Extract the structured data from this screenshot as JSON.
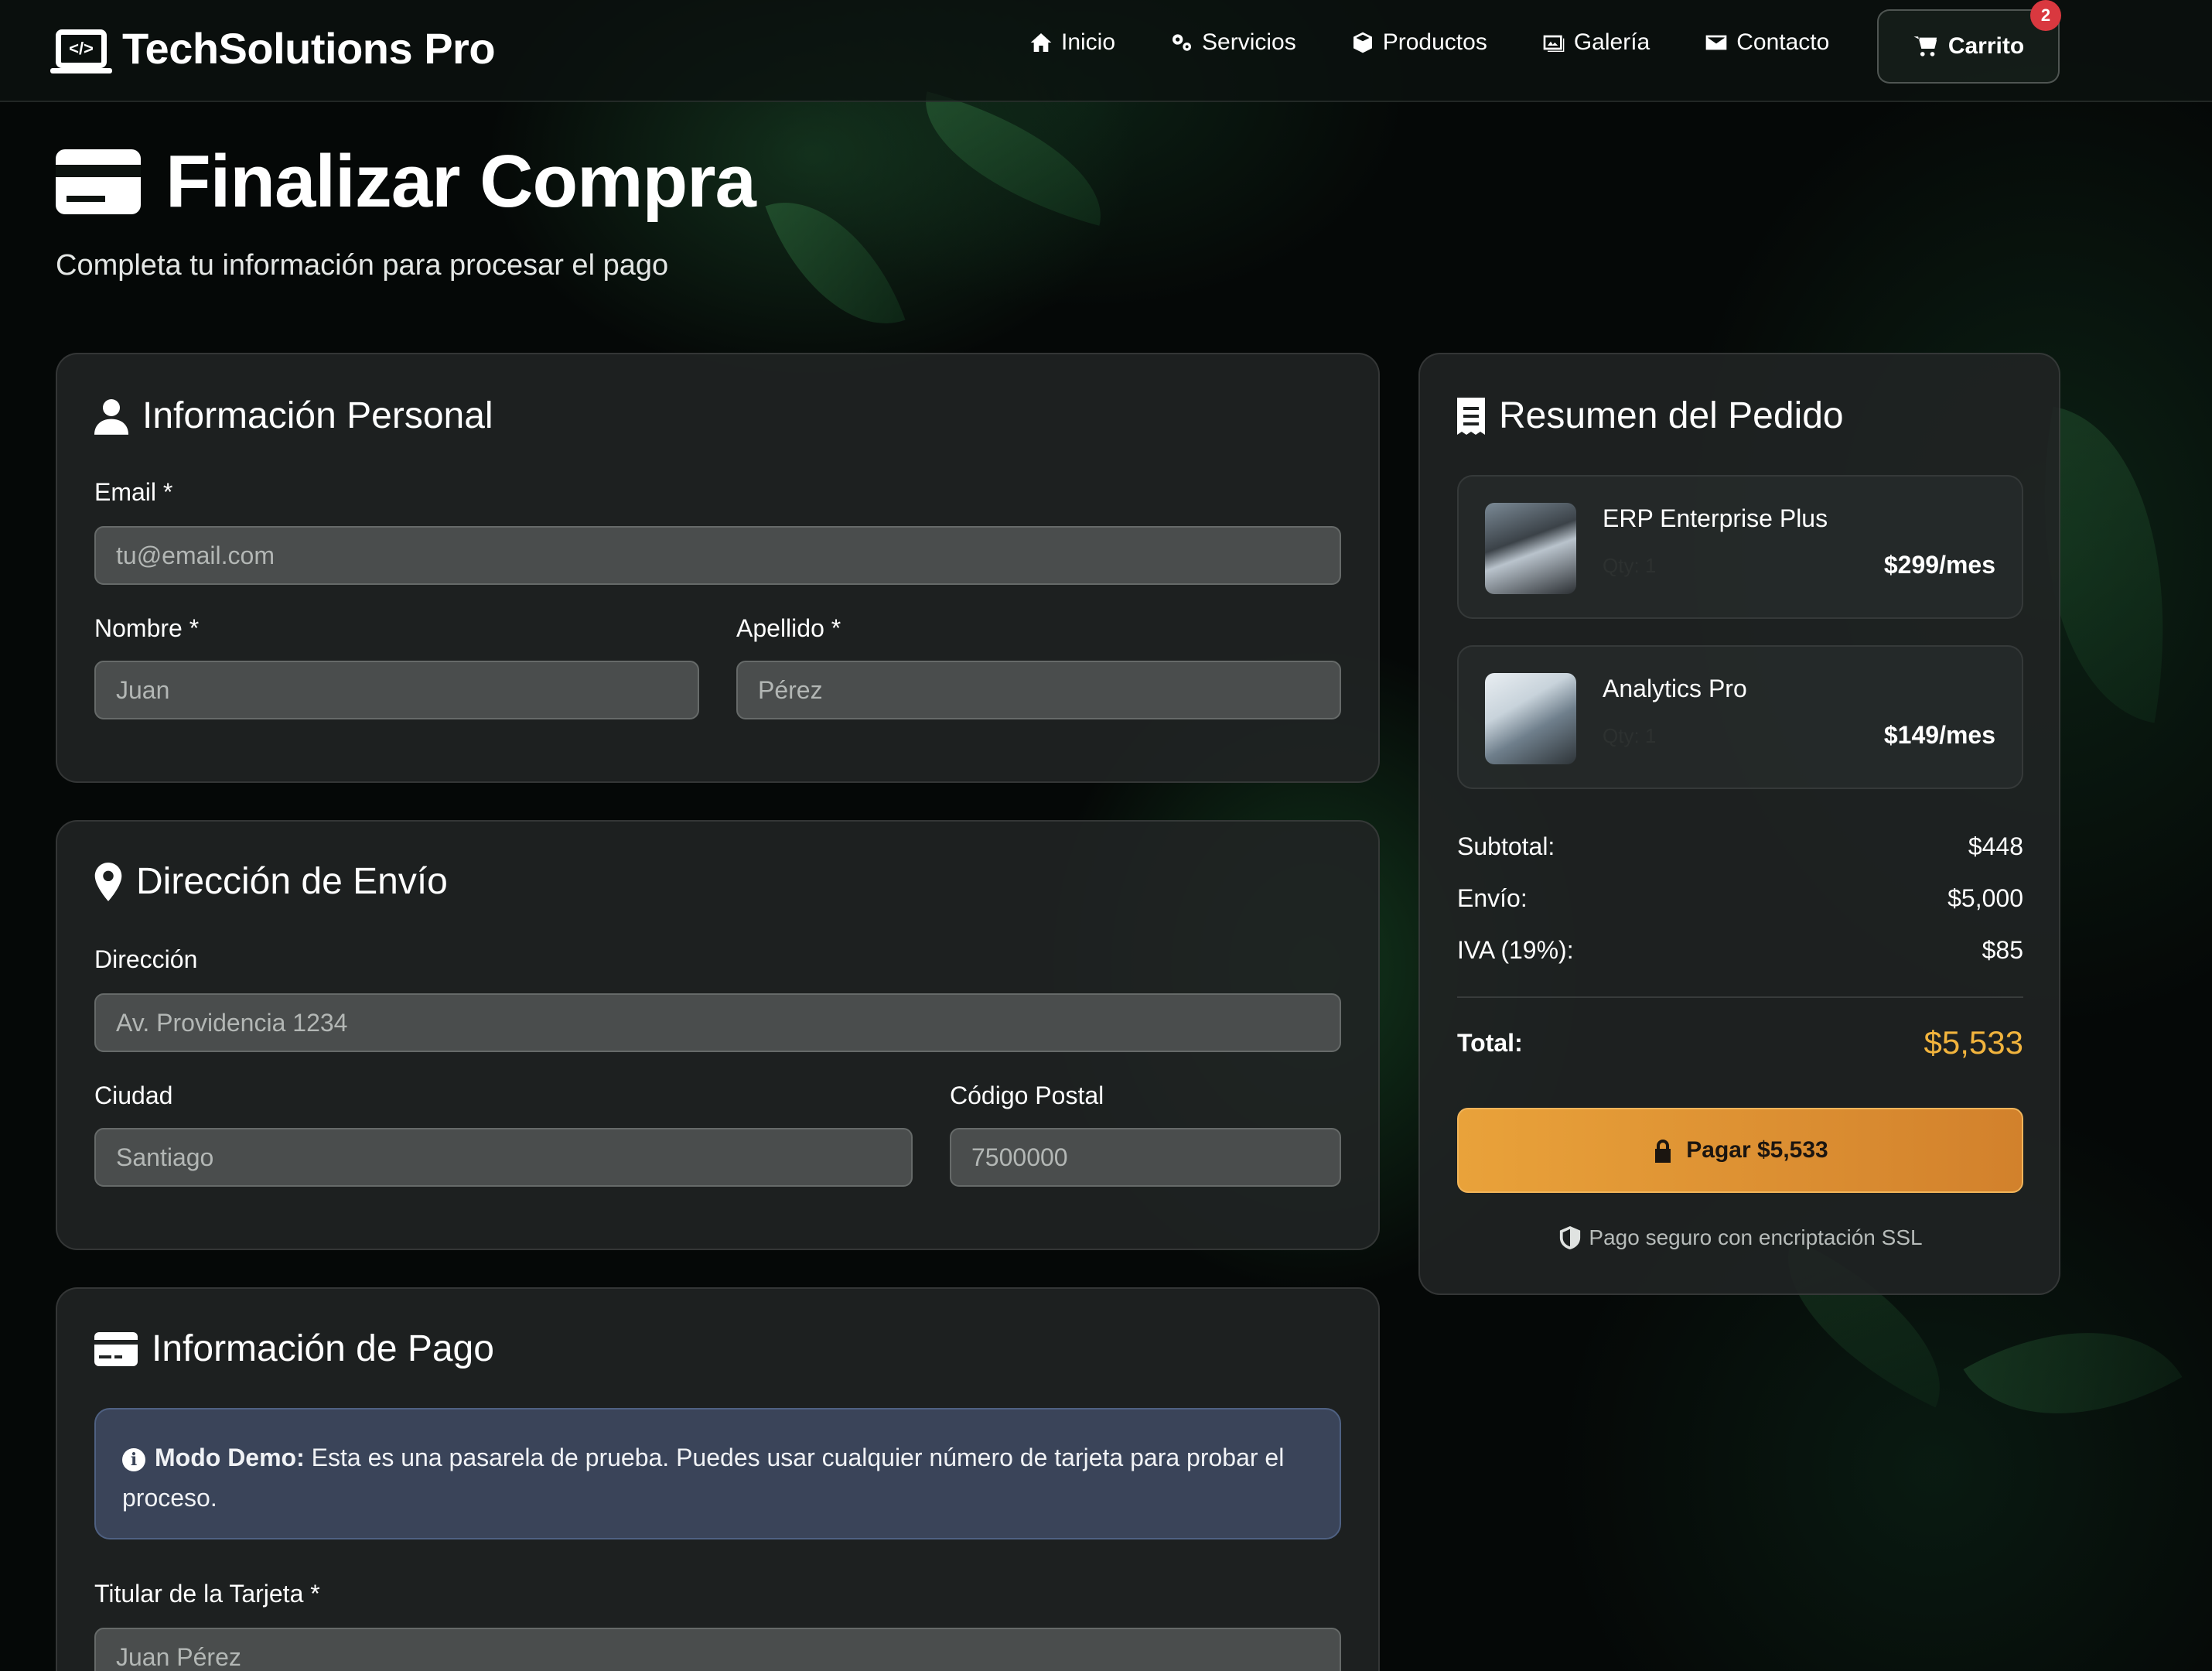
{
  "nav": {
    "brand": "TechSolutions Pro",
    "links": [
      {
        "label": "Inicio",
        "icon": "home-icon"
      },
      {
        "label": "Servicios",
        "icon": "gears-icon"
      },
      {
        "label": "Productos",
        "icon": "box-icon"
      },
      {
        "label": "Galería",
        "icon": "images-icon"
      },
      {
        "label": "Contacto",
        "icon": "envelope-icon"
      }
    ],
    "cart": {
      "label": "Carrito",
      "count": "2"
    }
  },
  "hero": {
    "title": "Finalizar Compra",
    "subtitle": "Completa tu información para procesar el pago"
  },
  "personal": {
    "title": "Información Personal",
    "email_label": "Email *",
    "email_placeholder": "tu@email.com",
    "name_label": "Nombre *",
    "name_placeholder": "Juan",
    "lastname_label": "Apellido *",
    "lastname_placeholder": "Pérez"
  },
  "shipping": {
    "title": "Dirección de Envío",
    "address_label": "Dirección",
    "address_placeholder": "Av. Providencia 1234",
    "city_label": "Ciudad",
    "city_placeholder": "Santiago",
    "zip_label": "Código Postal",
    "zip_placeholder": "7500000"
  },
  "payment": {
    "title": "Información de Pago",
    "alert_strong": "Modo Demo:",
    "alert_text": "Esta es una pasarela de prueba. Puedes usar cualquier número de tarjeta para probar el proceso.",
    "holder_label": "Titular de la Tarjeta *",
    "holder_placeholder": "Juan Pérez"
  },
  "summary": {
    "title": "Resumen del Pedido",
    "items": [
      {
        "name": "ERP Enterprise Plus",
        "qty": "Qty: 1",
        "price": "$299/mes"
      },
      {
        "name": "Analytics Pro",
        "qty": "Qty: 1",
        "price": "$149/mes"
      }
    ],
    "subtotal_label": "Subtotal:",
    "subtotal_value": "$448",
    "shipping_label": "Envío:",
    "shipping_value": "$5,000",
    "tax_label": "IVA (19%):",
    "tax_value": "$85",
    "total_label": "Total:",
    "total_value": "$5,533",
    "pay_label": "Pagar $5,533",
    "secure_text": "Pago seguro con encriptación SSL"
  },
  "colors": {
    "accent": "#f2b43d",
    "pay_button": "#e9a23a",
    "badge": "#d9383f",
    "alert_bg": "#3a4459"
  }
}
